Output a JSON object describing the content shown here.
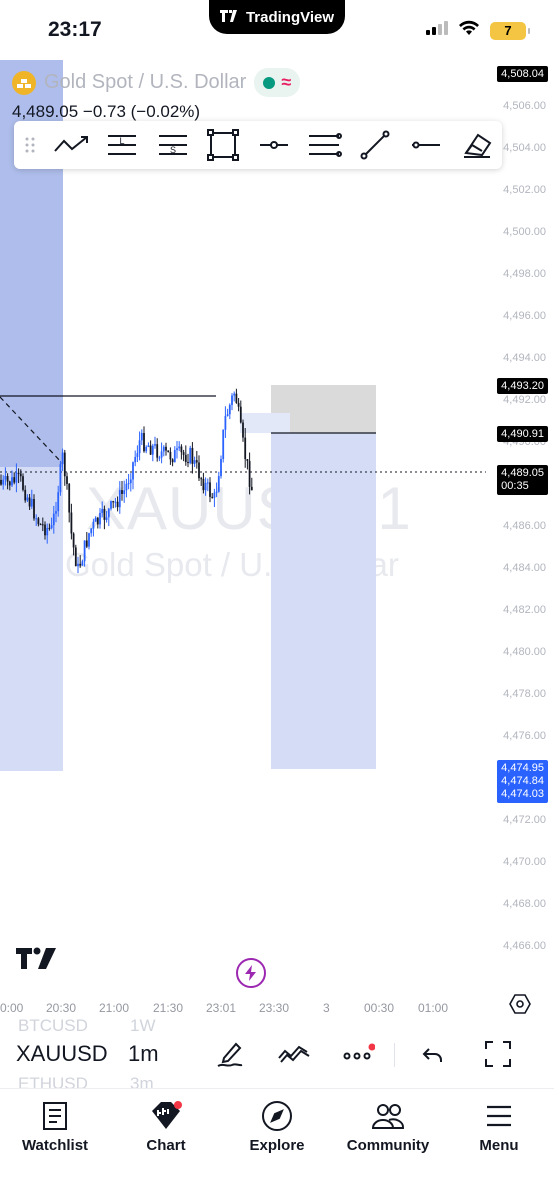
{
  "status_bar": {
    "time": "23:17",
    "island_label": "TradingView",
    "battery": "7"
  },
  "chart": {
    "symbol_name": "Gold Spot / U.S. Dollar",
    "ohlc_text": "4,489.05 −0.73 (−0.02%)",
    "watermark_symbol": "XAUUSD, 1",
    "watermark_description": "Gold Spot / U.S. Dollar",
    "price_axis_labels": [
      "4,506.00",
      "4,504.00",
      "4,502.00",
      "4,500.00",
      "4,498.00",
      "4,496.00",
      "4,494.00",
      "4,492.00",
      "4,490.00",
      "4,488.00",
      "4,486.00",
      "4,484.00",
      "4,482.00",
      "4,480.00",
      "4,478.00",
      "4,476.00",
      "4,472.00",
      "4,470.00",
      "4,468.00",
      "4,466.00"
    ],
    "price_tags": {
      "top": "4,508.04",
      "level_1": "4,493.20",
      "level_2": "4,490.91",
      "last_price": "4,489.05",
      "countdown": "00:35",
      "blue_1": "4,474.95",
      "blue_2": "4,474.84",
      "blue_3": "4,474.03"
    },
    "time_labels": [
      "0:00",
      "20:30",
      "21:00",
      "21:30",
      "23:01",
      "23:30",
      "3",
      "00:30",
      "01:00"
    ]
  },
  "drawing_toolbar": {
    "tools": [
      "trend-line-tool",
      "long-position-tool",
      "short-position-tool",
      "rectangle-tool",
      "horizontal-ray-tool",
      "horizontal-lines-tool",
      "line-tool",
      "horizontal-line-tool",
      "eraser-tool"
    ],
    "long_letter": "L",
    "short_letter": "S"
  },
  "symbol_strip": {
    "prev_symbol": "BTCUSD",
    "prev_timeframe": "1W",
    "current_symbol": "XAUUSD",
    "current_timeframe": "1m",
    "next_symbol": "ETHUSD",
    "next_timeframe": "3m"
  },
  "bottom_nav": {
    "items": [
      {
        "label": "Watchlist",
        "icon": "watchlist-icon"
      },
      {
        "label": "Chart",
        "icon": "chart-icon"
      },
      {
        "label": "Explore",
        "icon": "compass-icon"
      },
      {
        "label": "Community",
        "icon": "community-icon"
      },
      {
        "label": "Menu",
        "icon": "menu-icon"
      }
    ]
  },
  "colors": {
    "bull": "#2962ff",
    "bear": "#131722",
    "accent_blue": "#2962ff",
    "position_blue": "#d5dcf5",
    "position_blue_dark": "#aebdeb",
    "stop_gray": "#dadada",
    "market_open": "#089981",
    "notification": "#f23645",
    "bolt_purple": "#9c27b0"
  }
}
